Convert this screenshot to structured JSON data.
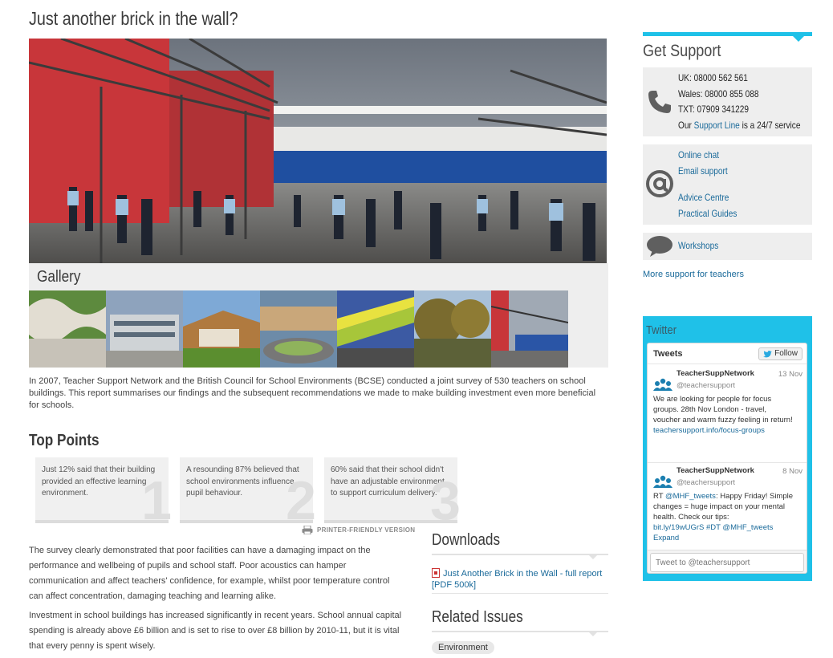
{
  "article": {
    "title": "Just another brick in the wall?",
    "gallery_title": "Gallery",
    "intro": "In 2007, Teacher Support Network and the British Council for School Environments (BCSE) conducted a joint survey of 530 teachers on school buildings. This report summarises our findings and the subsequent recommendations we made to make building investment even more beneficial for schools.",
    "top_points_title": "Top Points",
    "points": [
      {
        "text": "Just 12% said that their building provided an effective learning environment.",
        "num": "1"
      },
      {
        "text": "A resounding 87% believed that school environments influence pupil behaviour.",
        "num": "2"
      },
      {
        "text": "60% said that their school didn't have an adjustable environment to support curriculum delivery.",
        "num": "3"
      }
    ],
    "printer_label": "PRINTER-FRIENDLY VERSION",
    "paragraphs": [
      "The survey clearly demonstrated that poor facilities can have a damaging impact on the performance and wellbeing of pupils and school staff. Poor acoustics can hamper communication and affect teachers' confidence, for example, whilst poor temperature control can affect concentration, damaging teaching and learning alike.",
      "Investment in school buildings has increased significantly in recent years. School annual capital spending is already above £6 billion and is set to rise to over £8 billion by 2010-11, but it is vital that every penny is spent wisely."
    ]
  },
  "downloads": {
    "title": "Downloads",
    "link": "Just Another Brick in the Wall - full report [PDF 500k]"
  },
  "related": {
    "title": "Related Issues",
    "tag": "Environment"
  },
  "support": {
    "title": "Get Support",
    "phone_lines": [
      "UK: 08000 562 561",
      "Wales: 08000 855 088",
      "TXT: 07909 341229"
    ],
    "our": "Our",
    "support_line": "Support Line",
    "service": "is a 24/7 service",
    "online_chat": "Online chat",
    "email_support": "Email support",
    "advice_centre": "Advice Centre",
    "practical_guides": "Practical Guides",
    "workshops": "Workshops",
    "more": "More support for teachers"
  },
  "twitter": {
    "title": "Twitter",
    "tweets_label": "Tweets",
    "follow": "Follow",
    "tweets": [
      {
        "name": "TeacherSuppNetwork",
        "handle": "@teachersupport",
        "date": "13 Nov",
        "text": "We are looking for people for focus groups. 28th Nov London - travel, voucher and warm fuzzy feeling in return!",
        "link": "teachersupport.info/focus-groups"
      },
      {
        "name": "TeacherSuppNetwork",
        "handle": "@teachersupport",
        "date": "8 Nov",
        "rt": "RT",
        "mention": "@MHF_tweets",
        "text": ": Happy Friday! Simple changes = huge impact on your mental health. Check our tips:",
        "link": "bit.ly/19wUGrS",
        "hashtag": "#DT",
        "mention2": "@MHF_tweets",
        "expand": "Expand"
      }
    ],
    "compose_placeholder": "Tweet to @teachersupport"
  },
  "colors": {
    "accent": "#1fc1e8",
    "link": "#1a6a9a",
    "panel": "#eeeeee"
  }
}
